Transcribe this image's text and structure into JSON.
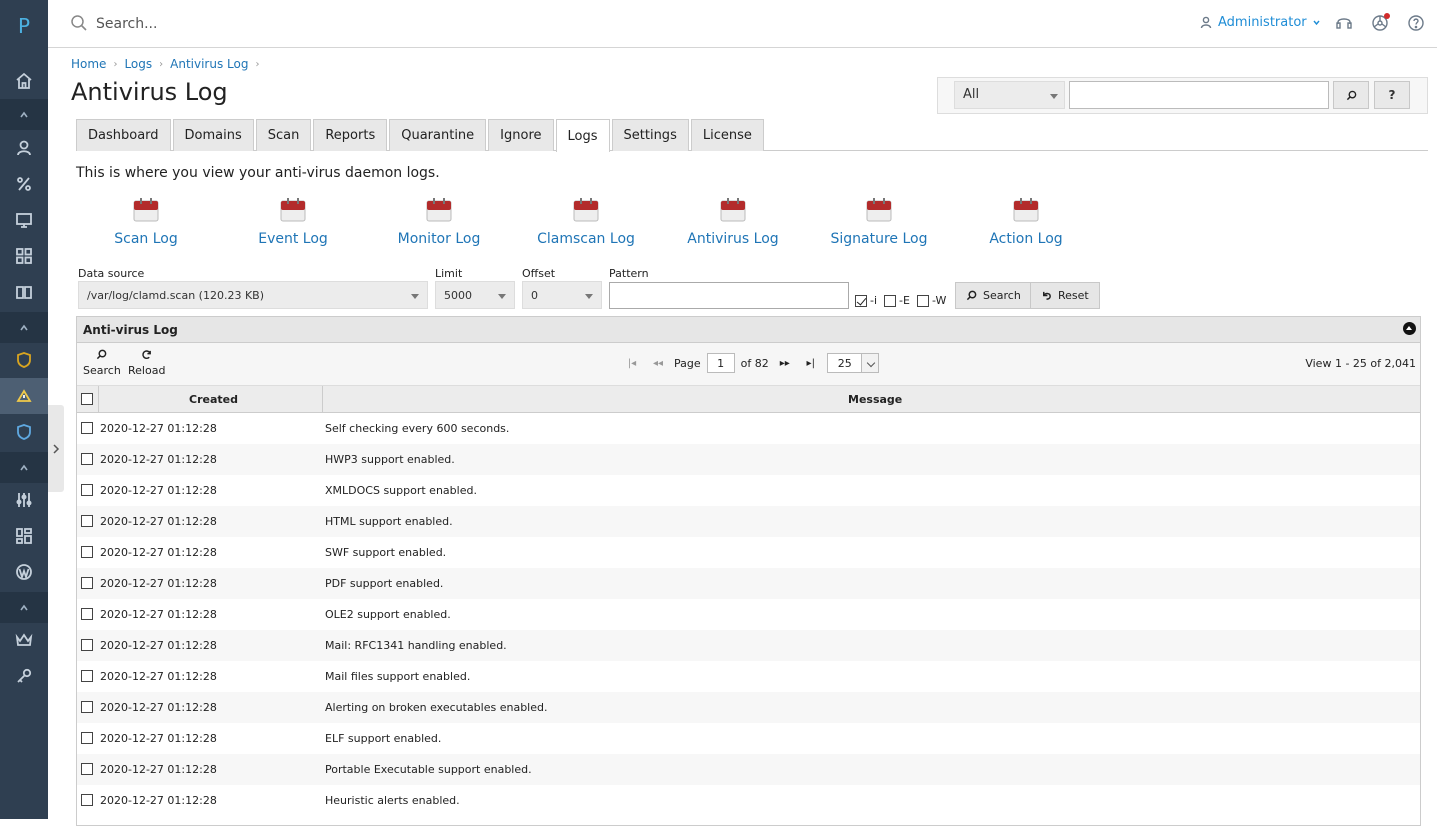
{
  "app": {
    "logo_letter": "P"
  },
  "topbar": {
    "search_placeholder": "Search...",
    "user_name": "Administrator"
  },
  "breadcrumb": [
    "Home",
    "Logs",
    "Antivirus Log"
  ],
  "page_title": "Antivirus Log",
  "filter": {
    "scope": "All",
    "search_button": "search-icon",
    "help_label": "?"
  },
  "tabs": [
    "Dashboard",
    "Domains",
    "Scan",
    "Reports",
    "Quarantine",
    "Ignore",
    "Logs",
    "Settings",
    "License"
  ],
  "active_tab": "Logs",
  "description": "This is where you view your anti-virus daemon logs.",
  "log_links": [
    "Scan Log",
    "Event Log",
    "Monitor Log",
    "Clamscan Log",
    "Antivirus Log",
    "Signature Log",
    "Action Log"
  ],
  "form": {
    "data_source_label": "Data source",
    "data_source_value": "/var/log/clamd.scan (120.23 KB)",
    "limit_label": "Limit",
    "limit_value": "5000",
    "offset_label": "Offset",
    "offset_value": "0",
    "pattern_label": "Pattern",
    "pattern_value": "",
    "flags": [
      {
        "label": "-i",
        "checked": true
      },
      {
        "label": "-E",
        "checked": false
      },
      {
        "label": "-W",
        "checked": false
      }
    ],
    "search_button": "Search",
    "reset_button": "Reset"
  },
  "grid": {
    "caption": "Anti-virus Log",
    "toolbar": {
      "search": "Search",
      "reload": "Reload"
    },
    "pager": {
      "page_label": "Page",
      "page": "1",
      "of_label": "of 82",
      "page_size": "25"
    },
    "view_info": "View 1 - 25 of 2,041",
    "columns": [
      "Created",
      "Message"
    ],
    "rows": [
      {
        "created": "2020-12-27 01:12:28",
        "message": "Self checking every 600 seconds."
      },
      {
        "created": "2020-12-27 01:12:28",
        "message": "HWP3 support enabled."
      },
      {
        "created": "2020-12-27 01:12:28",
        "message": "XMLDOCS support enabled."
      },
      {
        "created": "2020-12-27 01:12:28",
        "message": "HTML support enabled."
      },
      {
        "created": "2020-12-27 01:12:28",
        "message": "SWF support enabled."
      },
      {
        "created": "2020-12-27 01:12:28",
        "message": "PDF support enabled."
      },
      {
        "created": "2020-12-27 01:12:28",
        "message": "OLE2 support enabled."
      },
      {
        "created": "2020-12-27 01:12:28",
        "message": "Mail: RFC1341 handling enabled."
      },
      {
        "created": "2020-12-27 01:12:28",
        "message": "Mail files support enabled."
      },
      {
        "created": "2020-12-27 01:12:28",
        "message": "Alerting on broken executables enabled."
      },
      {
        "created": "2020-12-27 01:12:28",
        "message": "ELF support enabled."
      },
      {
        "created": "2020-12-27 01:12:28",
        "message": "Portable Executable support enabled."
      },
      {
        "created": "2020-12-27 01:12:28",
        "message": "Heuristic alerts enabled."
      }
    ]
  }
}
